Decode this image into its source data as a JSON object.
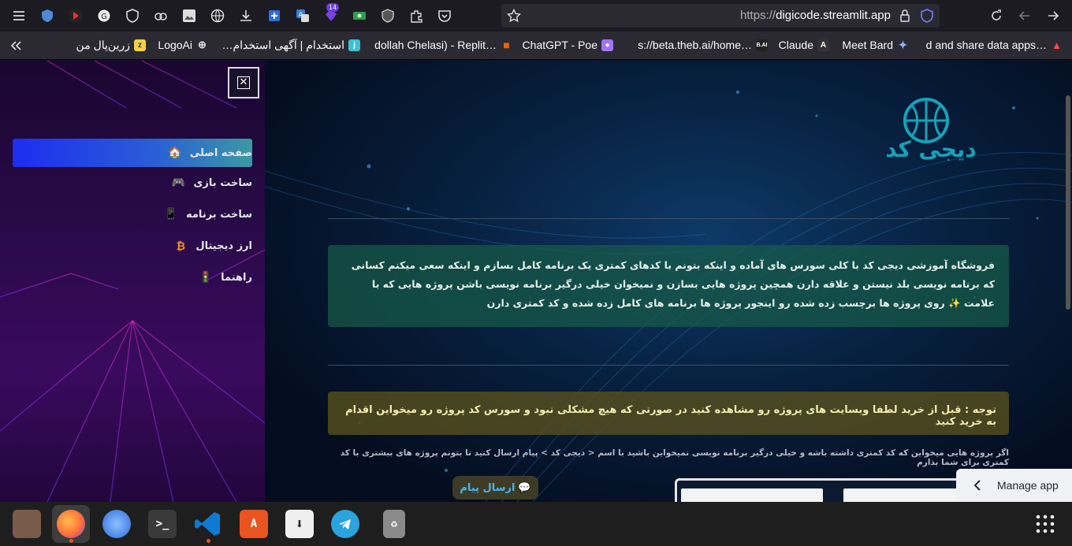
{
  "browser": {
    "url_prefix": "https://",
    "url_host": "digicode.streamlit.app",
    "extension_badge": "14"
  },
  "bookmarks": [
    {
      "label": "d and share data apps…",
      "icon": "streamlit-icon",
      "color": "#ff4b4b"
    },
    {
      "label": "Meet Bard",
      "icon": "bard-sparkle-icon",
      "color": "#8ab4f8"
    },
    {
      "label": "Claude",
      "icon": "anthropic-icon",
      "color": "#333333"
    },
    {
      "label": "s://beta.theb.ai/home…",
      "icon": "thebai-icon",
      "color": "#222222"
    },
    {
      "label": "ChatGPT - Poe",
      "icon": "poe-icon",
      "color": "#a074f7"
    },
    {
      "label": "dollah Chelasi) - Replit…",
      "icon": "replit-icon",
      "color": "#f26207"
    },
    {
      "label": "استخدام | آگهی استخدام…",
      "icon": "jobinja-icon",
      "color": "#3ec1d3"
    },
    {
      "label": "LogoAi",
      "icon": "globe-icon",
      "color": "#555555"
    },
    {
      "label": "زرین‌پال من",
      "icon": "zarinpal-icon",
      "color": "#f7d046"
    }
  ],
  "sidebar": {
    "items": [
      {
        "label": "صفحه اصلی",
        "icon": "house-icon",
        "glyph": "🏠",
        "active": true
      },
      {
        "label": "ساخت بازی",
        "icon": "gamepad-icon",
        "glyph": "🎮",
        "active": false
      },
      {
        "label": "ساخت برنامه",
        "icon": "phone-icon",
        "glyph": "📱",
        "active": false
      },
      {
        "label": "ارز دیجیتال",
        "icon": "bitcoin-icon",
        "glyph": "₿",
        "active": false
      },
      {
        "label": "راهنما",
        "icon": "traffic-light-icon",
        "glyph": "🚦",
        "active": false
      }
    ]
  },
  "main": {
    "logo_text": "دیجی کد",
    "info": "فروشگاه آموزشی دیجی کد با کلی سورس های آماده و اینکه بتونم با کدهای کمتری یک برنامه کامل بسازم و اینکه سعی میکنم کسانی که برنامه نویسی بلد نیستن و علاقه دارن همچین پروژه هایی بسازن و نمیخوان خیلی درگیر برنامه نویسی باشن پروژه هایی که با علامت ✨ روی پروژه ها برچسب زده شده رو اینجور پروژه ها برنامه های کامل زده شده و کد کمتری دارن",
    "warning": "توجه : قبل از خرید لطفا وبسایت های پروژه رو مشاهده کنید در صورتی که هیچ مشکلی نبود و سورس کد پروژه رو میخواین اقدام به خرید کنید",
    "note": "اگر پروژه هایی میخواین که کد کمتری داشته باشه و خیلی درگیر برنامه نویسی نمیخواین باشید با اسم < دیجی کد > پیام ارسال کنید تا بتونم پروژه های بیشتری با کد کمتری برای شما بذارم",
    "send_button": "ارسال پیام",
    "send_icon": "speech-bubble-icon",
    "manage_app": "Manage app"
  },
  "taskbar": {
    "apps": [
      {
        "name": "files-app",
        "color": "#7a5a4a"
      },
      {
        "name": "firefox-app",
        "color": "#ff7139",
        "active": true
      },
      {
        "name": "thunderbird-app",
        "color": "#2a6bd8"
      },
      {
        "name": "terminal-app",
        "color": "#3a3a3a",
        "glyph": ">_"
      },
      {
        "name": "vscode-app",
        "color": "#0e7ad3"
      },
      {
        "name": "software-app",
        "color": "#e95420"
      },
      {
        "name": "downloader-app",
        "color": "#efefef"
      },
      {
        "name": "telegram-app",
        "color": "#2aa3de"
      },
      {
        "name": "trash-app",
        "color": "#6b6b6b"
      }
    ]
  }
}
